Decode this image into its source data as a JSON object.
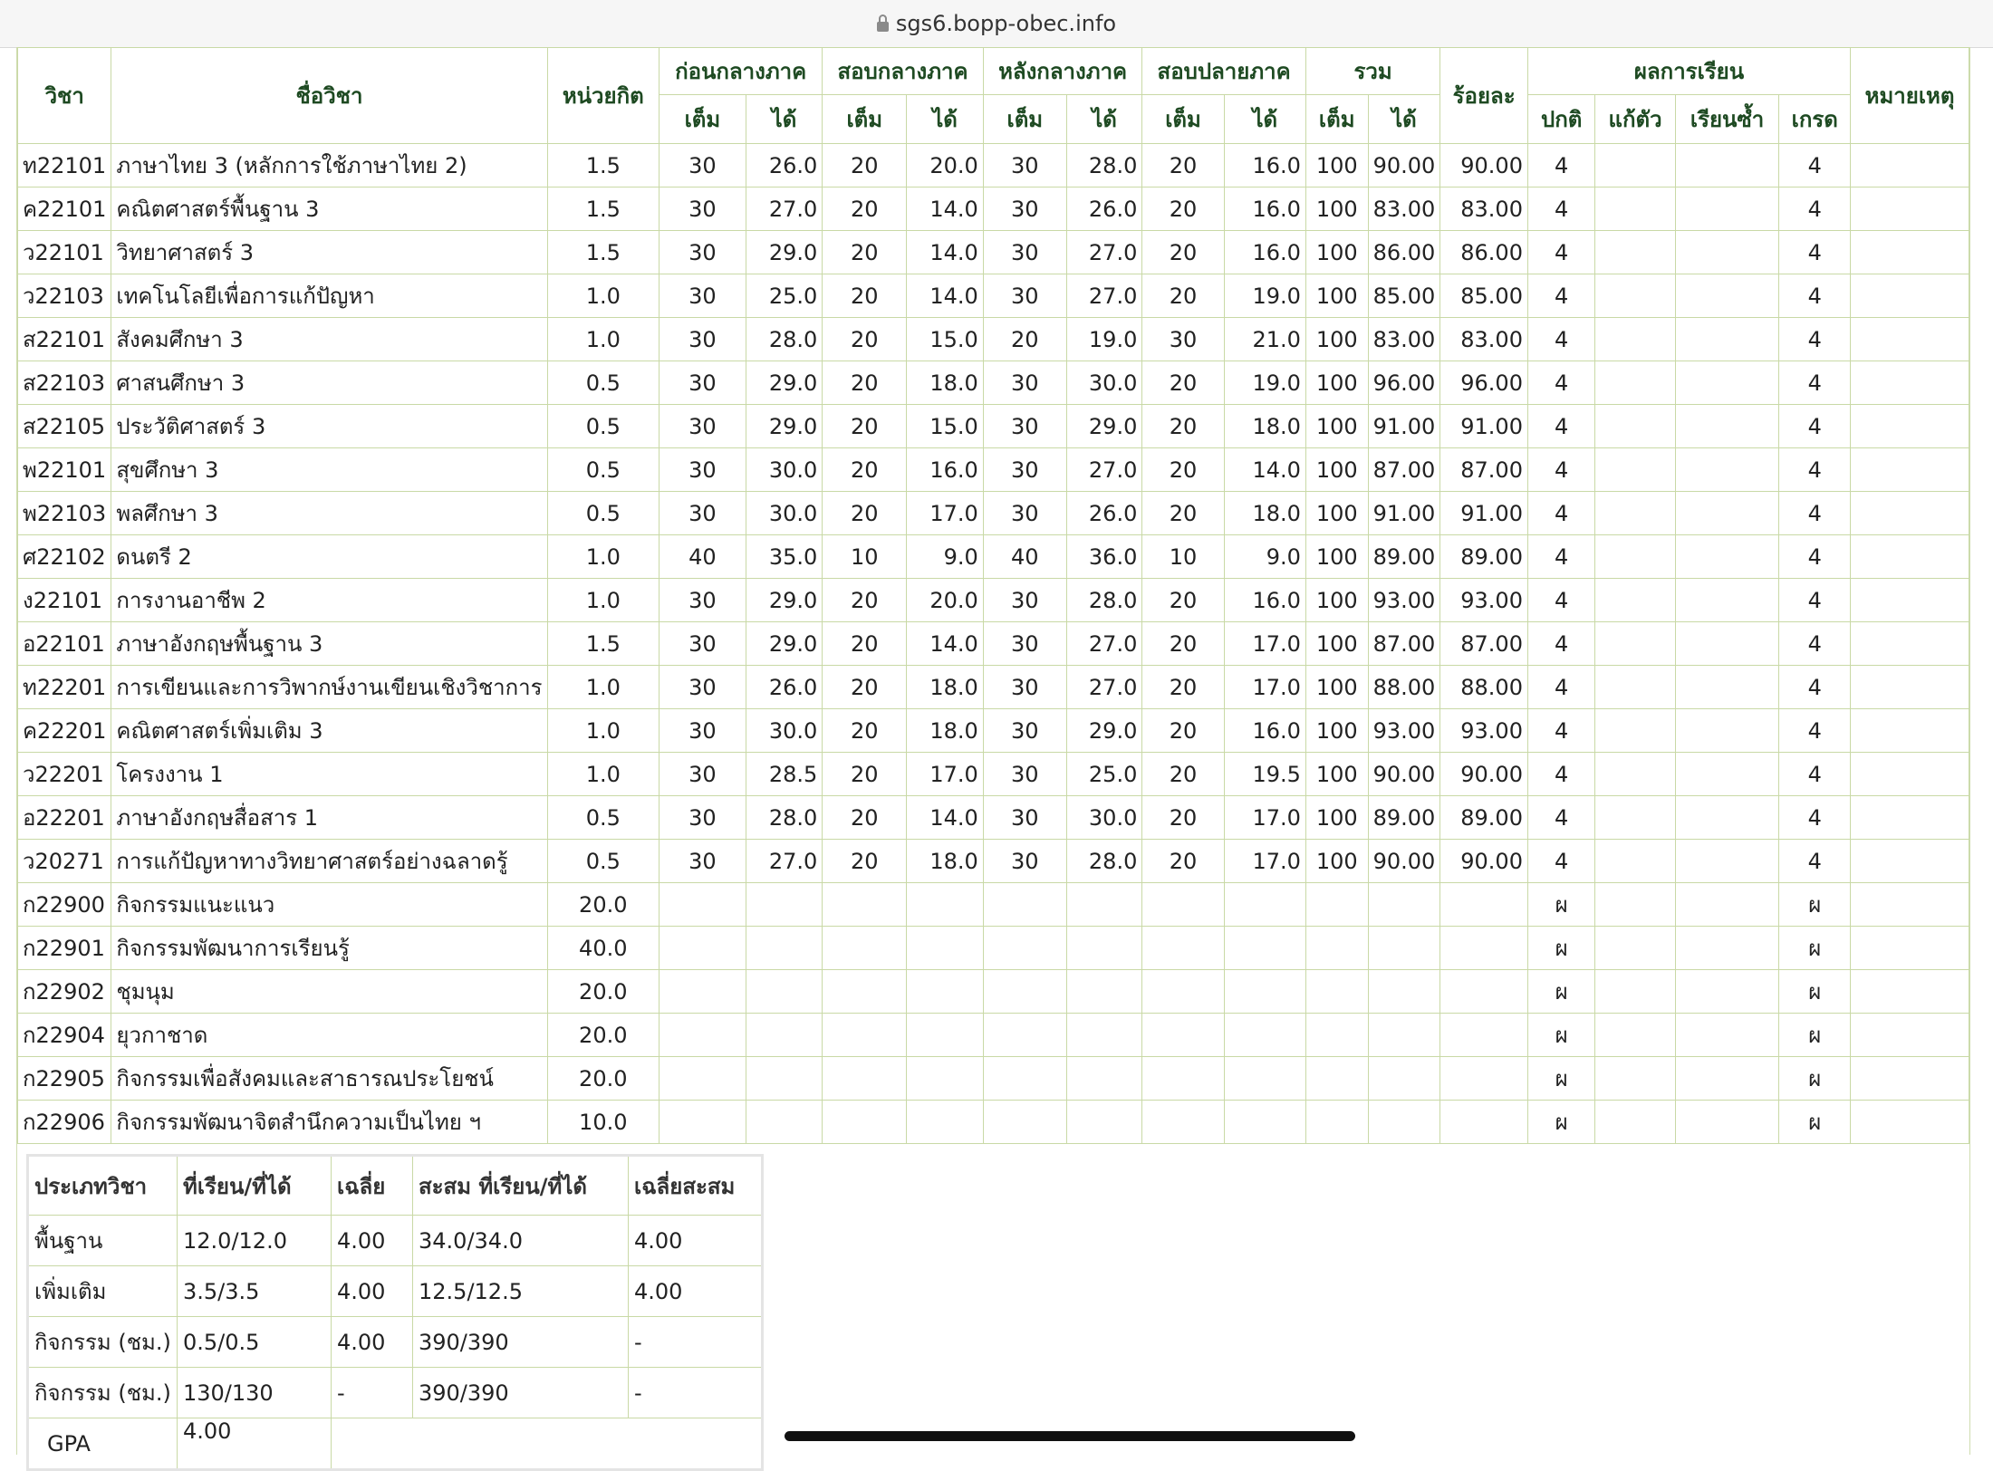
{
  "browser": {
    "url": "sgs6.bopp-obec.info"
  },
  "grades_table": {
    "headers": {
      "code": "วิชา",
      "name": "ชื่อวิชา",
      "credit": "หน่วยกิต",
      "groups": [
        "ก่อนกลางภาค",
        "สอบกลางภาค",
        "หลังกลางภาค",
        "สอบปลายภาค",
        "รวม"
      ],
      "full": "เต็ม",
      "got": "ได้",
      "percent": "ร้อยละ",
      "result_group": "ผลการเรียน",
      "result_cols": [
        "ปกติ",
        "แก้ตัว",
        "เรียนซ้ำ",
        "เกรด"
      ],
      "remark": "หมายเหตุ"
    },
    "rows": [
      {
        "code": "ท22101",
        "name": "ภาษาไทย 3 (หลักการใช้ภาษาไทย 2)",
        "credit": "1.5",
        "s": [
          "30",
          "26.0",
          "20",
          "20.0",
          "30",
          "28.0",
          "20",
          "16.0",
          "100",
          "90.00"
        ],
        "pct": "90.00",
        "normal": "4",
        "retake": "",
        "repeat": "",
        "grade": "4",
        "remark": ""
      },
      {
        "code": "ค22101",
        "name": "คณิตศาสตร์พื้นฐาน 3",
        "credit": "1.5",
        "s": [
          "30",
          "27.0",
          "20",
          "14.0",
          "30",
          "26.0",
          "20",
          "16.0",
          "100",
          "83.00"
        ],
        "pct": "83.00",
        "normal": "4",
        "retake": "",
        "repeat": "",
        "grade": "4",
        "remark": ""
      },
      {
        "code": "ว22101",
        "name": "วิทยาศาสตร์ 3",
        "credit": "1.5",
        "s": [
          "30",
          "29.0",
          "20",
          "14.0",
          "30",
          "27.0",
          "20",
          "16.0",
          "100",
          "86.00"
        ],
        "pct": "86.00",
        "normal": "4",
        "retake": "",
        "repeat": "",
        "grade": "4",
        "remark": ""
      },
      {
        "code": "ว22103",
        "name": "เทคโนโลยีเพื่อการแก้ปัญหา",
        "credit": "1.0",
        "s": [
          "30",
          "25.0",
          "20",
          "14.0",
          "30",
          "27.0",
          "20",
          "19.0",
          "100",
          "85.00"
        ],
        "pct": "85.00",
        "normal": "4",
        "retake": "",
        "repeat": "",
        "grade": "4",
        "remark": ""
      },
      {
        "code": "ส22101",
        "name": "สังคมศึกษา 3",
        "credit": "1.0",
        "s": [
          "30",
          "28.0",
          "20",
          "15.0",
          "20",
          "19.0",
          "30",
          "21.0",
          "100",
          "83.00"
        ],
        "pct": "83.00",
        "normal": "4",
        "retake": "",
        "repeat": "",
        "grade": "4",
        "remark": ""
      },
      {
        "code": "ส22103",
        "name": "ศาสนศึกษา 3",
        "credit": "0.5",
        "s": [
          "30",
          "29.0",
          "20",
          "18.0",
          "30",
          "30.0",
          "20",
          "19.0",
          "100",
          "96.00"
        ],
        "pct": "96.00",
        "normal": "4",
        "retake": "",
        "repeat": "",
        "grade": "4",
        "remark": ""
      },
      {
        "code": "ส22105",
        "name": "ประวัติศาสตร์ 3",
        "credit": "0.5",
        "s": [
          "30",
          "29.0",
          "20",
          "15.0",
          "30",
          "29.0",
          "20",
          "18.0",
          "100",
          "91.00"
        ],
        "pct": "91.00",
        "normal": "4",
        "retake": "",
        "repeat": "",
        "grade": "4",
        "remark": ""
      },
      {
        "code": "พ22101",
        "name": "สุขศึกษา 3",
        "credit": "0.5",
        "s": [
          "30",
          "30.0",
          "20",
          "16.0",
          "30",
          "27.0",
          "20",
          "14.0",
          "100",
          "87.00"
        ],
        "pct": "87.00",
        "normal": "4",
        "retake": "",
        "repeat": "",
        "grade": "4",
        "remark": ""
      },
      {
        "code": "พ22103",
        "name": "พลศึกษา 3",
        "credit": "0.5",
        "s": [
          "30",
          "30.0",
          "20",
          "17.0",
          "30",
          "26.0",
          "20",
          "18.0",
          "100",
          "91.00"
        ],
        "pct": "91.00",
        "normal": "4",
        "retake": "",
        "repeat": "",
        "grade": "4",
        "remark": ""
      },
      {
        "code": "ศ22102",
        "name": "ดนตรี 2",
        "credit": "1.0",
        "s": [
          "40",
          "35.0",
          "10",
          "9.0",
          "40",
          "36.0",
          "10",
          "9.0",
          "100",
          "89.00"
        ],
        "pct": "89.00",
        "normal": "4",
        "retake": "",
        "repeat": "",
        "grade": "4",
        "remark": ""
      },
      {
        "code": "ง22101",
        "name": "การงานอาชีพ 2",
        "credit": "1.0",
        "s": [
          "30",
          "29.0",
          "20",
          "20.0",
          "30",
          "28.0",
          "20",
          "16.0",
          "100",
          "93.00"
        ],
        "pct": "93.00",
        "normal": "4",
        "retake": "",
        "repeat": "",
        "grade": "4",
        "remark": ""
      },
      {
        "code": "อ22101",
        "name": "ภาษาอังกฤษพื้นฐาน 3",
        "credit": "1.5",
        "s": [
          "30",
          "29.0",
          "20",
          "14.0",
          "30",
          "27.0",
          "20",
          "17.0",
          "100",
          "87.00"
        ],
        "pct": "87.00",
        "normal": "4",
        "retake": "",
        "repeat": "",
        "grade": "4",
        "remark": ""
      },
      {
        "code": "ท22201",
        "name": "การเขียนและการวิพากษ์งานเขียนเชิงวิชาการ",
        "credit": "1.0",
        "s": [
          "30",
          "26.0",
          "20",
          "18.0",
          "30",
          "27.0",
          "20",
          "17.0",
          "100",
          "88.00"
        ],
        "pct": "88.00",
        "normal": "4",
        "retake": "",
        "repeat": "",
        "grade": "4",
        "remark": ""
      },
      {
        "code": "ค22201",
        "name": "คณิตศาสตร์เพิ่มเติม 3",
        "credit": "1.0",
        "s": [
          "30",
          "30.0",
          "20",
          "18.0",
          "30",
          "29.0",
          "20",
          "16.0",
          "100",
          "93.00"
        ],
        "pct": "93.00",
        "normal": "4",
        "retake": "",
        "repeat": "",
        "grade": "4",
        "remark": ""
      },
      {
        "code": "ว22201",
        "name": "โครงงาน 1",
        "credit": "1.0",
        "s": [
          "30",
          "28.5",
          "20",
          "17.0",
          "30",
          "25.0",
          "20",
          "19.5",
          "100",
          "90.00"
        ],
        "pct": "90.00",
        "normal": "4",
        "retake": "",
        "repeat": "",
        "grade": "4",
        "remark": ""
      },
      {
        "code": "อ22201",
        "name": "ภาษาอังกฤษสื่อสาร 1",
        "credit": "0.5",
        "s": [
          "30",
          "28.0",
          "20",
          "14.0",
          "30",
          "30.0",
          "20",
          "17.0",
          "100",
          "89.00"
        ],
        "pct": "89.00",
        "normal": "4",
        "retake": "",
        "repeat": "",
        "grade": "4",
        "remark": ""
      },
      {
        "code": "ว20271",
        "name": "การแก้ปัญหาทางวิทยาศาสตร์อย่างฉลาดรู้",
        "credit": "0.5",
        "s": [
          "30",
          "27.0",
          "20",
          "18.0",
          "30",
          "28.0",
          "20",
          "17.0",
          "100",
          "90.00"
        ],
        "pct": "90.00",
        "normal": "4",
        "retake": "",
        "repeat": "",
        "grade": "4",
        "remark": ""
      },
      {
        "code": "ก22900",
        "name": "กิจกรรมแนะแนว",
        "credit": "20.0",
        "s": [
          "",
          "",
          "",
          "",
          "",
          "",
          "",
          "",
          "",
          ""
        ],
        "pct": "",
        "normal": "ผ",
        "retake": "",
        "repeat": "",
        "grade": "ผ",
        "remark": ""
      },
      {
        "code": "ก22901",
        "name": "กิจกรรมพัฒนาการเรียนรู้",
        "credit": "40.0",
        "s": [
          "",
          "",
          "",
          "",
          "",
          "",
          "",
          "",
          "",
          ""
        ],
        "pct": "",
        "normal": "ผ",
        "retake": "",
        "repeat": "",
        "grade": "ผ",
        "remark": ""
      },
      {
        "code": "ก22902",
        "name": "ชุมนุม",
        "credit": "20.0",
        "s": [
          "",
          "",
          "",
          "",
          "",
          "",
          "",
          "",
          "",
          ""
        ],
        "pct": "",
        "normal": "ผ",
        "retake": "",
        "repeat": "",
        "grade": "ผ",
        "remark": ""
      },
      {
        "code": "ก22904",
        "name": "ยุวกาชาด",
        "credit": "20.0",
        "s": [
          "",
          "",
          "",
          "",
          "",
          "",
          "",
          "",
          "",
          ""
        ],
        "pct": "",
        "normal": "ผ",
        "retake": "",
        "repeat": "",
        "grade": "ผ",
        "remark": ""
      },
      {
        "code": "ก22905",
        "name": "กิจกรรมเพื่อสังคมและสาธารณประโยชน์",
        "credit": "20.0",
        "s": [
          "",
          "",
          "",
          "",
          "",
          "",
          "",
          "",
          "",
          ""
        ],
        "pct": "",
        "normal": "ผ",
        "retake": "",
        "repeat": "",
        "grade": "ผ",
        "remark": ""
      },
      {
        "code": "ก22906",
        "name": "กิจกรรมพัฒนาจิตสำนึกความเป็นไทย ฯ",
        "credit": "10.0",
        "s": [
          "",
          "",
          "",
          "",
          "",
          "",
          "",
          "",
          "",
          ""
        ],
        "pct": "",
        "normal": "ผ",
        "retake": "",
        "repeat": "",
        "grade": "ผ",
        "remark": ""
      }
    ]
  },
  "summary_table": {
    "headers": [
      "ประเภทวิชา",
      "ที่เรียน/ที่ได้",
      "เฉลี่ย",
      "สะสม ที่เรียน/ที่ได้",
      "เฉลี่ยสะสม"
    ],
    "rows": [
      [
        "พื้นฐาน",
        "12.0/12.0",
        "4.00",
        "34.0/34.0",
        "4.00"
      ],
      [
        "เพิ่มเติม",
        "3.5/3.5",
        "4.00",
        "12.5/12.5",
        "4.00"
      ],
      [
        "กิจกรรม (ชม.)",
        "0.5/0.5",
        "4.00",
        "390/390",
        "-"
      ],
      [
        "กิจกรรม (ชม.)",
        "130/130",
        "-",
        "390/390",
        "-"
      ]
    ],
    "gpa_label": "GPA",
    "gpa_value": "4.00"
  }
}
